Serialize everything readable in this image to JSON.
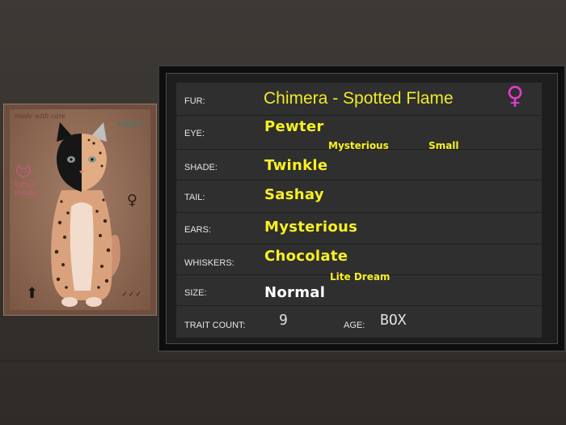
{
  "box_art": {
    "top_text": "made with care",
    "logo": "KIBBOS!",
    "kitten_label": "kitten inside",
    "gender_symbol": "♀",
    "arrow_symbol": "⬆",
    "checks": "✓✓✓"
  },
  "panel": {
    "rows": {
      "fur": {
        "label": "FUR:",
        "value": "Chimera - Spotted Flame"
      },
      "eye": {
        "label": "EYE:",
        "value": "Pewter",
        "sub_left": "Mysterious",
        "sub_right": "Small"
      },
      "shade": {
        "label": "SHADE:",
        "value": "Twinkle"
      },
      "tail": {
        "label": "TAIL:",
        "value": "Sashay"
      },
      "ears": {
        "label": "EARS:",
        "value": "Mysterious"
      },
      "whiskers": {
        "label": "WHISKERS:",
        "value": "Chocolate",
        "sub": "Lite Dream"
      },
      "size": {
        "label": "SIZE:",
        "value": "Normal"
      }
    },
    "trait_count": {
      "label": "TRAIT COUNT:",
      "value": "9"
    },
    "age": {
      "label": "AGE:",
      "value": "BOX"
    },
    "gender_symbol": "♀"
  },
  "colors": {
    "value_yellow": "#f7f024",
    "gender_magenta": "#e23ccc",
    "panel_bg": "#2f2f2f"
  }
}
